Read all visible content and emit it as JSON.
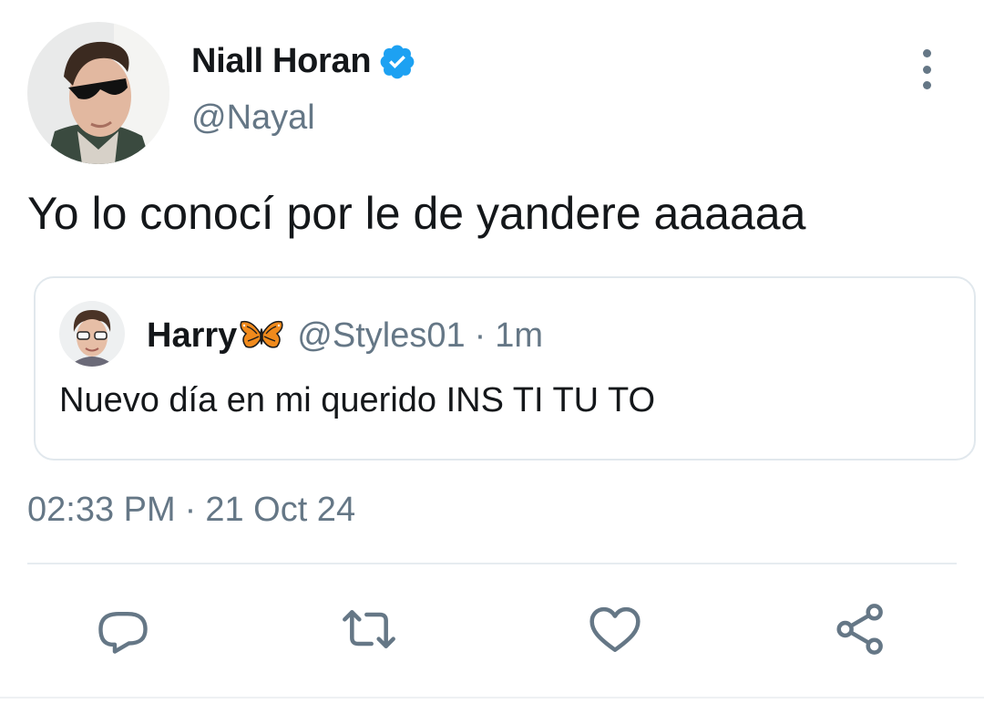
{
  "author": {
    "display_name": "Niall Horan",
    "handle": "@Nayal",
    "verified": true
  },
  "tweet": {
    "text": "Yo lo conocí por le de yandere aaaaaa",
    "time": "02:33 PM",
    "separator": "·",
    "date": "21 Oct 24"
  },
  "quoted": {
    "display_name": "Harry",
    "emoji": "butterfly",
    "handle": "@Styles01",
    "separator": "·",
    "time": "1m",
    "text": "Nuevo día en mi querido INS TI TU TO"
  },
  "icons": {
    "more": "more-vertical-icon",
    "reply": "reply-icon",
    "retweet": "retweet-icon",
    "like": "heart-icon",
    "share": "share-icon",
    "verified": "verified-badge-icon"
  },
  "colors": {
    "primary_text": "#14171a",
    "secondary_text": "#657786",
    "verified_blue": "#1da1f2",
    "border": "#e1e8ed"
  }
}
